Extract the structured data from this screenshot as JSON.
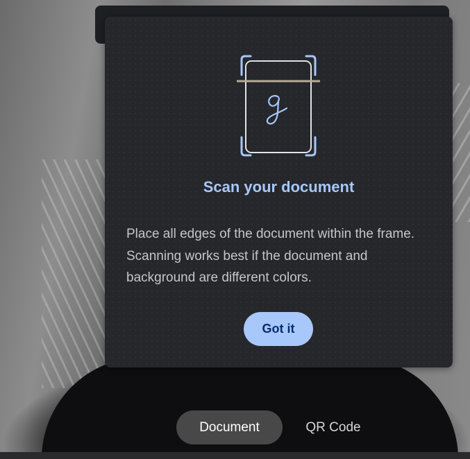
{
  "dialog": {
    "title": "Scan your document",
    "body": "Place all edges of the document within the frame. Scanning works best if the document and background are different colors.",
    "button_label": "Got it",
    "illustration_icon": "document-scan-icon",
    "accent_color": "#a8c7fa"
  },
  "mode_switch": {
    "items": [
      {
        "label": "Document",
        "selected": true
      },
      {
        "label": "QR Code",
        "selected": false
      }
    ]
  }
}
